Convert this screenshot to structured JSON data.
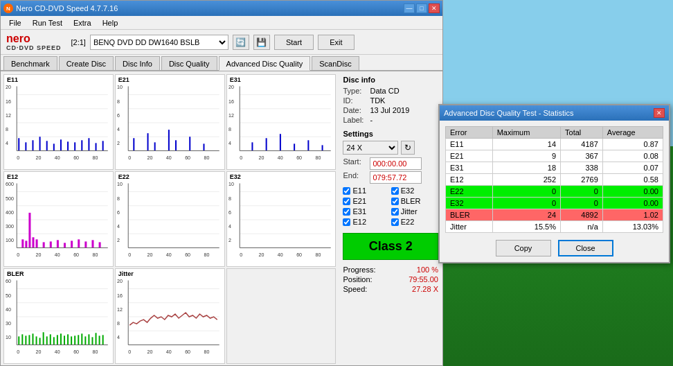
{
  "app": {
    "title": "Nero CD-DVD Speed 4.7.7.16",
    "icon": "●"
  },
  "title_buttons": {
    "minimize": "—",
    "maximize": "□",
    "close": "✕"
  },
  "menu": {
    "items": [
      "File",
      "Run Test",
      "Extra",
      "Help"
    ]
  },
  "toolbar": {
    "drive_label": "[2:1]",
    "drive_value": "BENQ DVD DD DW1640 BSLB",
    "start_label": "Start",
    "exit_label": "Exit"
  },
  "tabs": [
    {
      "id": "benchmark",
      "label": "Benchmark"
    },
    {
      "id": "create_disc",
      "label": "Create Disc"
    },
    {
      "id": "disc_info",
      "label": "Disc Info"
    },
    {
      "id": "disc_quality",
      "label": "Disc Quality"
    },
    {
      "id": "advanced_disc_quality",
      "label": "Advanced Disc Quality"
    },
    {
      "id": "scan_disc",
      "label": "ScanDisc"
    }
  ],
  "active_tab": "advanced_disc_quality",
  "charts": [
    {
      "id": "e11",
      "label": "E11",
      "color": "#0000cc",
      "max_y": 20
    },
    {
      "id": "e21",
      "label": "E21",
      "color": "#0000cc",
      "max_y": 10
    },
    {
      "id": "e31",
      "label": "E31",
      "color": "#0000cc",
      "max_y": 20
    },
    {
      "id": "e12",
      "label": "E12",
      "color": "#cc00cc",
      "max_y": 600
    },
    {
      "id": "e22",
      "label": "E22",
      "color": "#0000cc",
      "max_y": 10
    },
    {
      "id": "e32",
      "label": "E32",
      "color": "#0000cc",
      "max_y": 10
    },
    {
      "id": "bler",
      "label": "BLER",
      "color": "#00aa00",
      "max_y": 60
    },
    {
      "id": "jitter",
      "label": "Jitter",
      "color": "#cc0000",
      "max_y": 20
    }
  ],
  "disc_info": {
    "title": "Disc info",
    "type_label": "Type:",
    "type_value": "Data CD",
    "id_label": "ID:",
    "id_value": "TDK",
    "date_label": "Date:",
    "date_value": "13 Jul 2019",
    "label_label": "Label:",
    "label_value": "-"
  },
  "settings": {
    "title": "Settings",
    "speed_value": "24 X",
    "start_label": "Start:",
    "start_value": "000:00.00",
    "end_label": "End:",
    "end_value": "079:57.72"
  },
  "checkboxes": [
    {
      "id": "e11",
      "label": "E11",
      "checked": true
    },
    {
      "id": "e32",
      "label": "E32",
      "checked": true
    },
    {
      "id": "e21",
      "label": "E21",
      "checked": true
    },
    {
      "id": "bler",
      "label": "BLER",
      "checked": true
    },
    {
      "id": "e31",
      "label": "E31",
      "checked": true
    },
    {
      "id": "jitter",
      "label": "Jitter",
      "checked": true
    },
    {
      "id": "e12",
      "label": "E12",
      "checked": true
    },
    {
      "id": "e22",
      "label": "E22",
      "checked": true
    }
  ],
  "class_badge": {
    "label": "Class 2"
  },
  "progress": {
    "progress_label": "Progress:",
    "progress_value": "100 %",
    "position_label": "Position:",
    "position_value": "79:55.00",
    "speed_label": "Speed:",
    "speed_value": "27.28 X"
  },
  "stats_dialog": {
    "title": "Advanced Disc Quality Test - Statistics",
    "columns": [
      "Error",
      "Maximum",
      "Total",
      "Average"
    ],
    "rows": [
      {
        "error": "E11",
        "maximum": "14",
        "total": "4187",
        "average": "0.87",
        "highlight": "none"
      },
      {
        "error": "E21",
        "maximum": "9",
        "total": "367",
        "average": "0.08",
        "highlight": "none"
      },
      {
        "error": "E31",
        "maximum": "18",
        "total": "338",
        "average": "0.07",
        "highlight": "none"
      },
      {
        "error": "E12",
        "maximum": "252",
        "total": "2769",
        "average": "0.58",
        "highlight": "none"
      },
      {
        "error": "E22",
        "maximum": "0",
        "total": "0",
        "average": "0.00",
        "highlight": "green"
      },
      {
        "error": "E32",
        "maximum": "0",
        "total": "0",
        "average": "0.00",
        "highlight": "green"
      },
      {
        "error": "BLER",
        "maximum": "24",
        "total": "4892",
        "average": "1.02",
        "highlight": "red"
      },
      {
        "error": "Jitter",
        "maximum": "15.5%",
        "total": "n/a",
        "average": "13.03%",
        "highlight": "none"
      }
    ],
    "copy_label": "Copy",
    "close_label": "Close"
  }
}
